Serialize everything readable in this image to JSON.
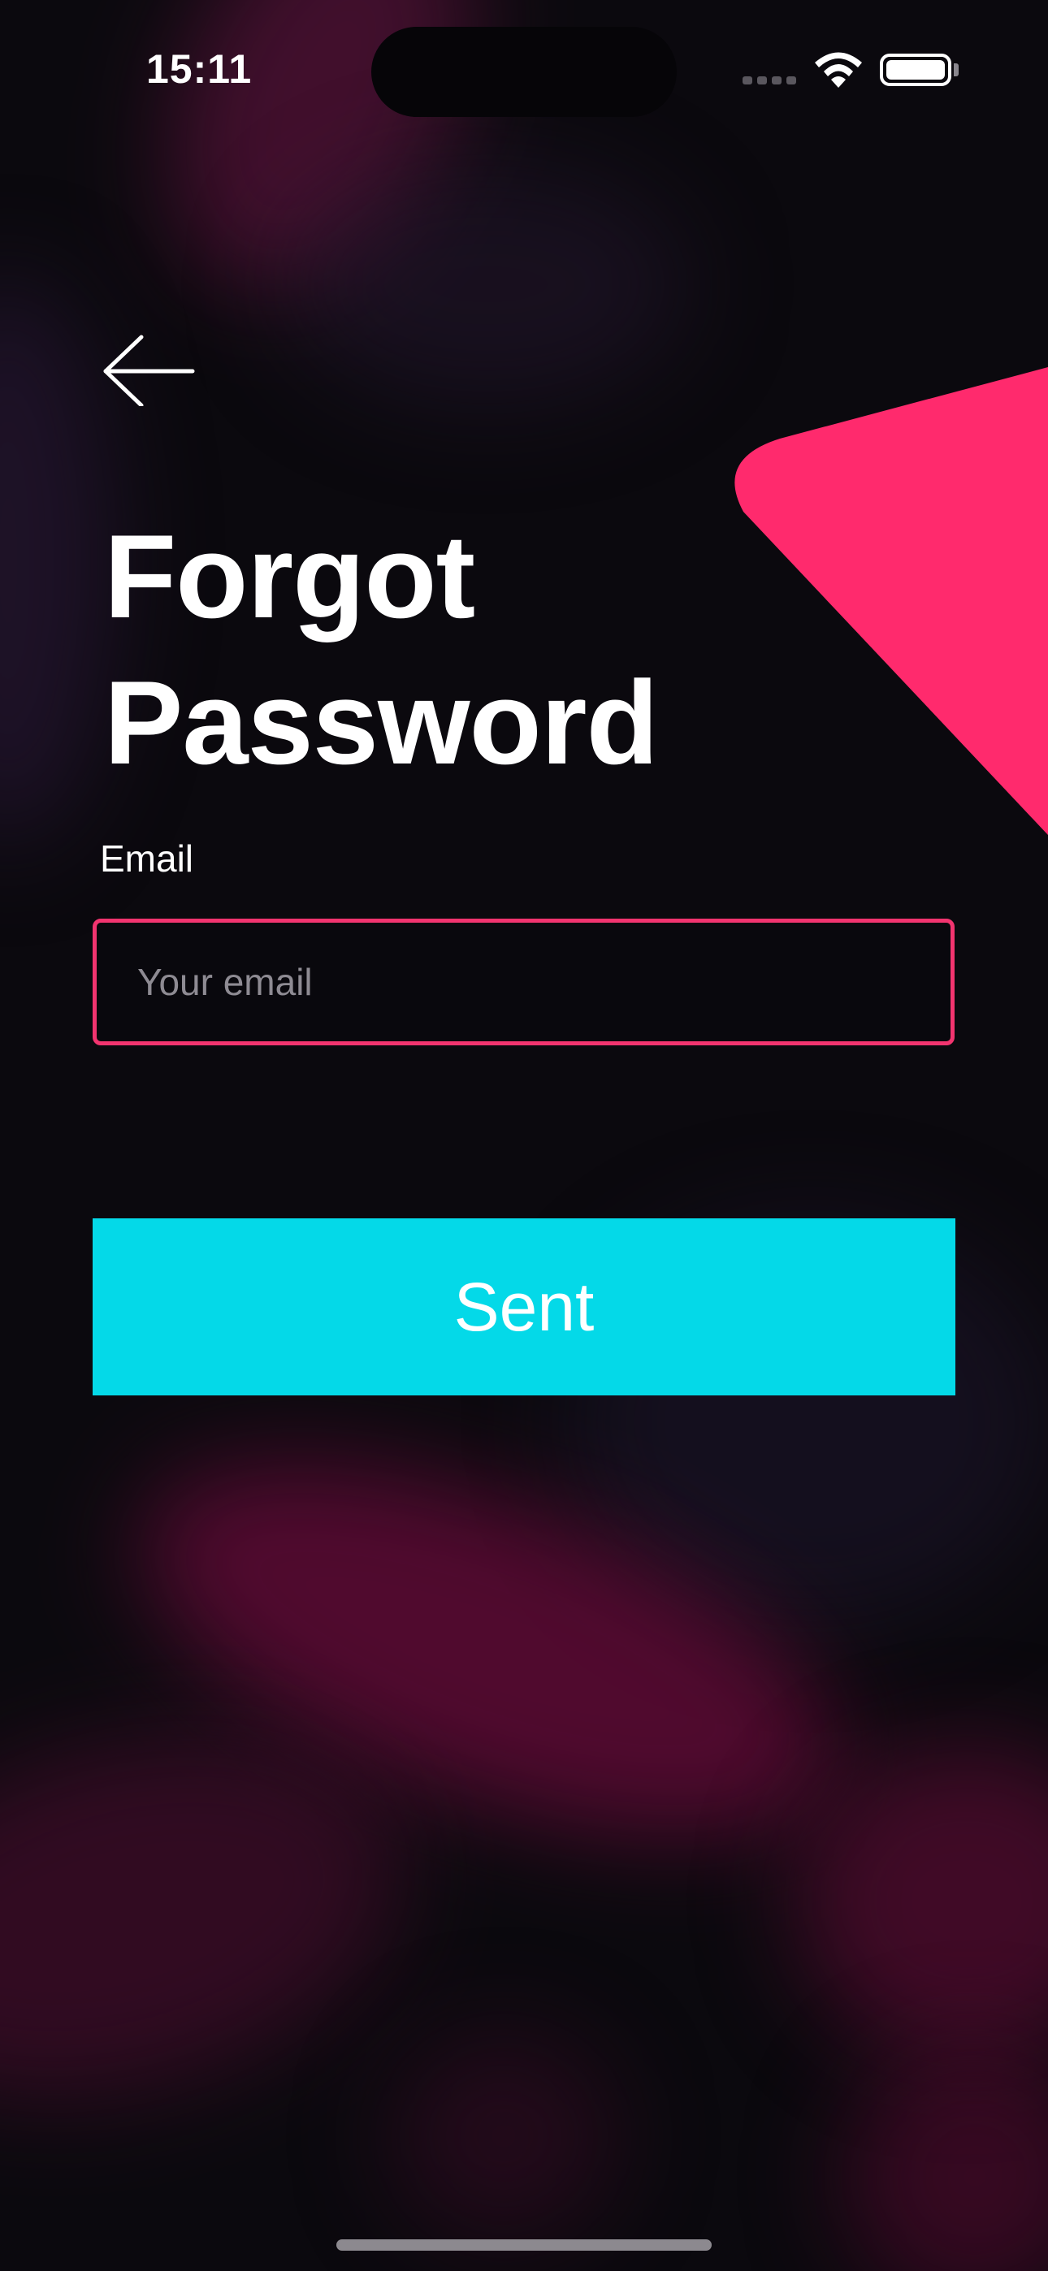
{
  "status_bar": {
    "time": "15:11",
    "icons": [
      "cellular-signal-icon",
      "wifi-icon",
      "battery-icon"
    ],
    "battery_level": 1.0
  },
  "nav": {
    "back_icon": "arrow-left-icon"
  },
  "header": {
    "title_line1": "Forgot",
    "title_line2": "Password"
  },
  "form": {
    "email_label": "Email",
    "email_value": "",
    "email_placeholder": "Your email",
    "submit_label": "Sent"
  },
  "colors": {
    "background": "#0b090e",
    "accent_pink": "#ff2a6d",
    "input_border": "#f2346f",
    "button_cyan": "#04d9e8",
    "text": "#ffffff",
    "placeholder": "#8e8b93"
  }
}
